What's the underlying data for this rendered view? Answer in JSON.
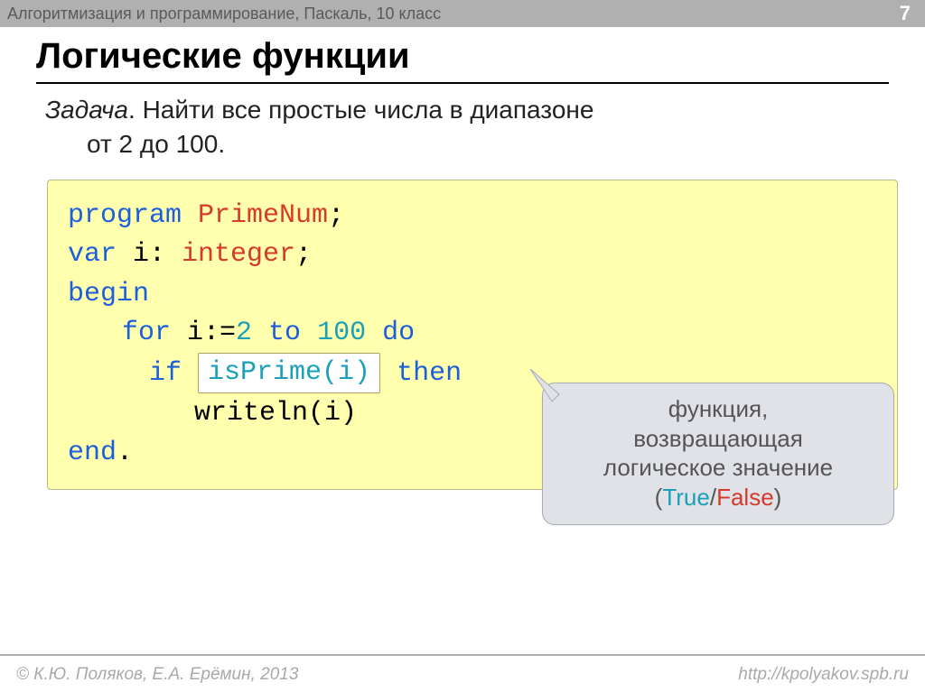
{
  "header": {
    "breadcrumb": "Алгоритмизация и программирование, Паскаль, 10 класс",
    "page": "7"
  },
  "title": "Логические функции",
  "task": {
    "label": "Задача",
    "dot": ". ",
    "line1_rest": "Найти все простые числа в диапазоне",
    "line2": "от 2 до 100."
  },
  "code": {
    "l1_kw": "program",
    "l1_name": " PrimeNum",
    "l1_semi": ";",
    "l2_kw": "var",
    "l2_mid": " i: ",
    "l2_type": "integer",
    "l2_semi": ";",
    "l3": "begin",
    "l4_for": "for",
    "l4_assign": " i:=",
    "l4_two": "2",
    "l4_to": " to ",
    "l4_hund": "100",
    "l4_do": " do",
    "l5_if": "if",
    "l5_box": "isPrime(i)",
    "l5_then": " then",
    "l6": "writeln(i)",
    "l7_end": "end",
    "l7_dot": "."
  },
  "callout": {
    "line1": "функция,",
    "line2": "возвращающая",
    "line3": "логическое значение",
    "paren_open": "(",
    "true": "True",
    "slash": "/",
    "false": "False",
    "paren_close": ")"
  },
  "footer": {
    "left": "© К.Ю. Поляков, Е.А. Ерёмин, 2013",
    "right": "http://kpolyakov.spb.ru"
  }
}
